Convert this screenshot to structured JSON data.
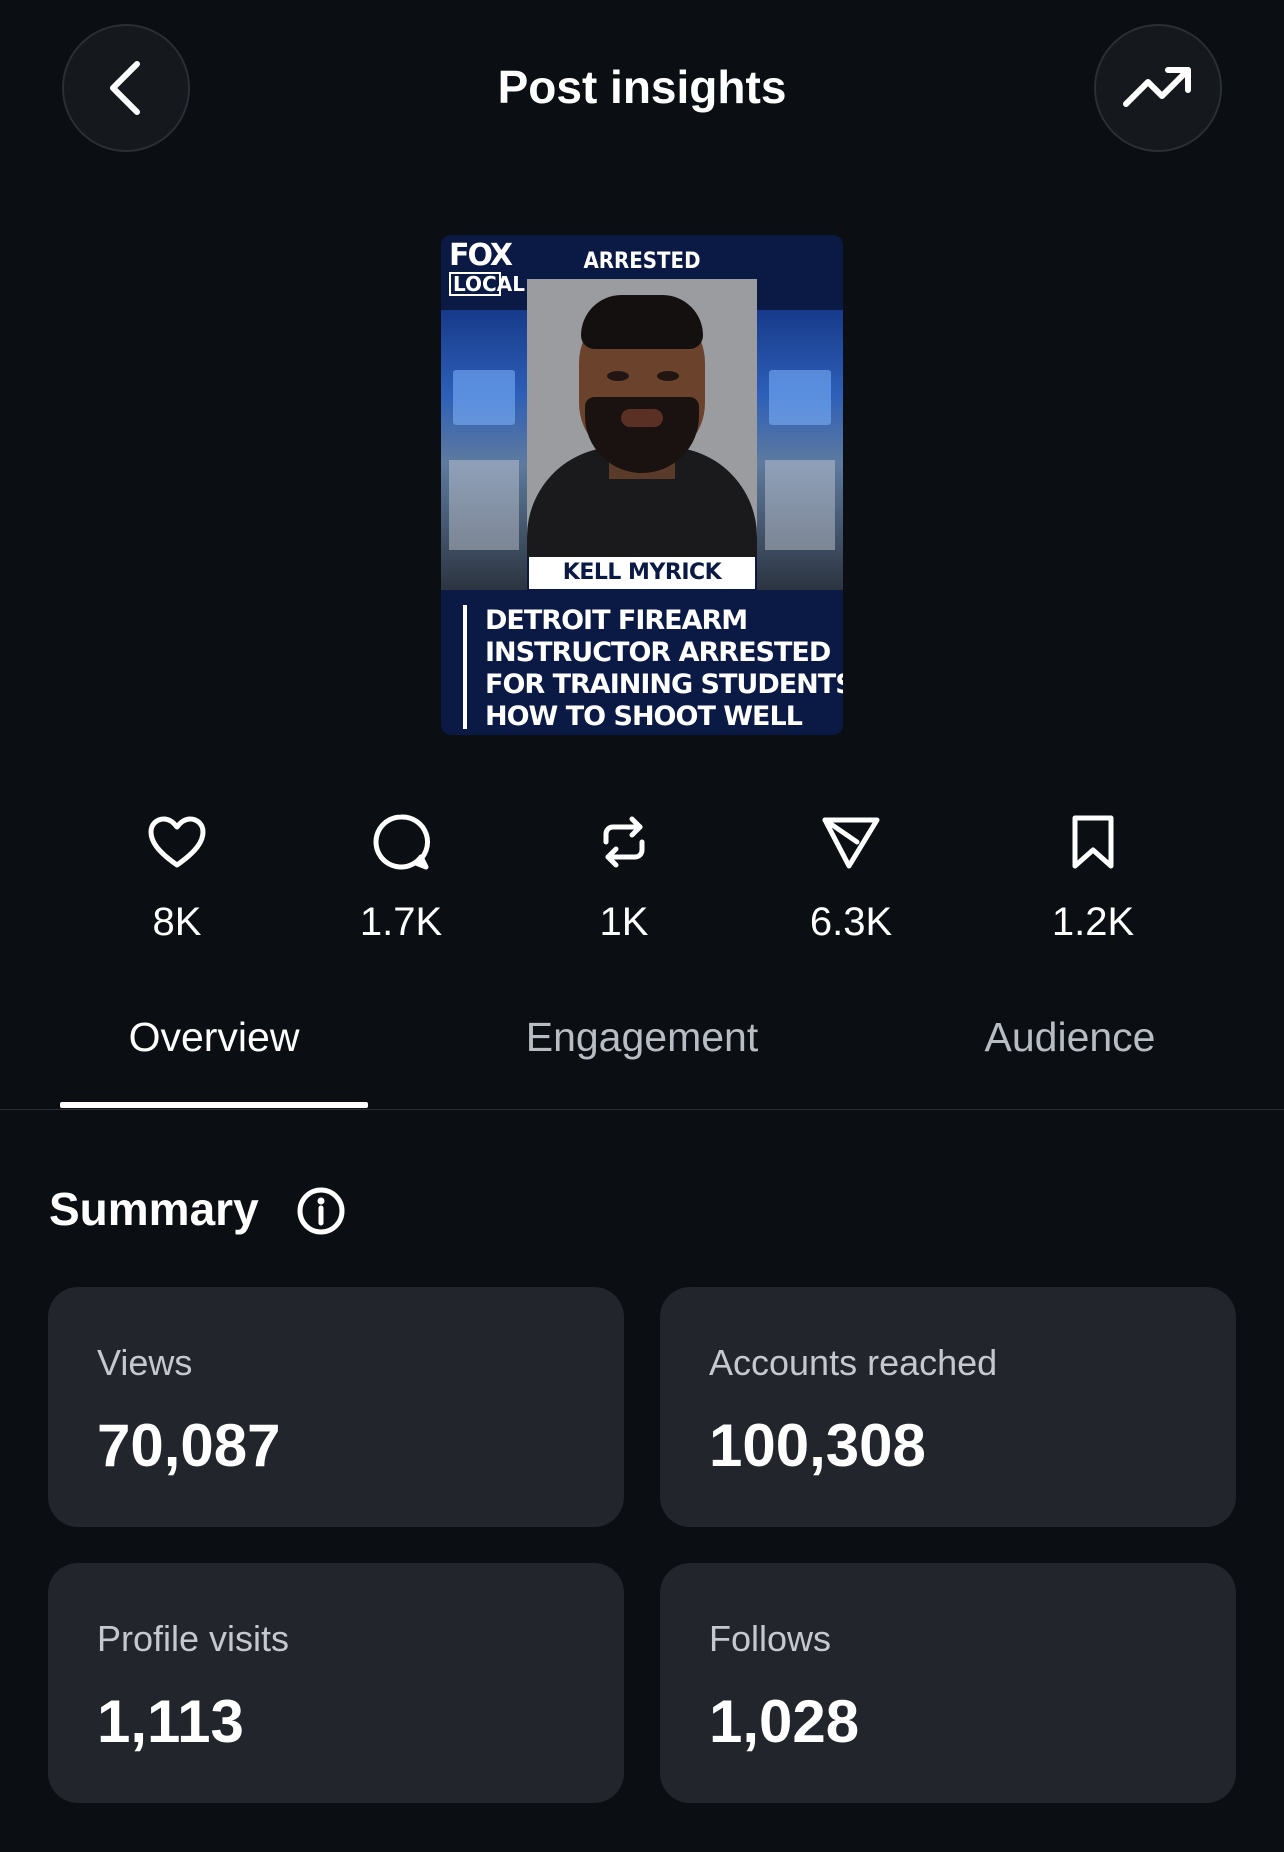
{
  "header": {
    "title": "Post insights",
    "back_icon": "chevron-left-icon",
    "trend_icon": "trending-up-icon"
  },
  "thumbnail": {
    "logo_line1": "FOX",
    "logo_line2": "LOCAL",
    "top_label": "ARRESTED",
    "name_label": "KELL MYRICK",
    "headline": [
      "DETROIT FIREARM",
      "INSTRUCTOR ARRESTED",
      "FOR TRAINING STUDENTS",
      "HOW TO SHOOT WELL"
    ]
  },
  "stats": [
    {
      "icon": "heart-icon",
      "value": "8K"
    },
    {
      "icon": "comment-icon",
      "value": "1.7K"
    },
    {
      "icon": "repost-icon",
      "value": "1K"
    },
    {
      "icon": "send-icon",
      "value": "6.3K"
    },
    {
      "icon": "bookmark-icon",
      "value": "1.2K"
    }
  ],
  "tabs": [
    {
      "label": "Overview",
      "active": true
    },
    {
      "label": "Engagement",
      "active": false
    },
    {
      "label": "Audience",
      "active": false
    }
  ],
  "summary": {
    "title": "Summary",
    "info_icon": "info-icon",
    "cards": [
      {
        "label": "Views",
        "value": "70,087"
      },
      {
        "label": "Accounts reached",
        "value": "100,308"
      },
      {
        "label": "Profile visits",
        "value": "1,113"
      },
      {
        "label": "Follows",
        "value": "1,028"
      }
    ]
  },
  "colors": {
    "background": "#0b0e13",
    "card": "#22252b",
    "text_primary": "#ffffff",
    "text_secondary": "#c5c9cf"
  }
}
